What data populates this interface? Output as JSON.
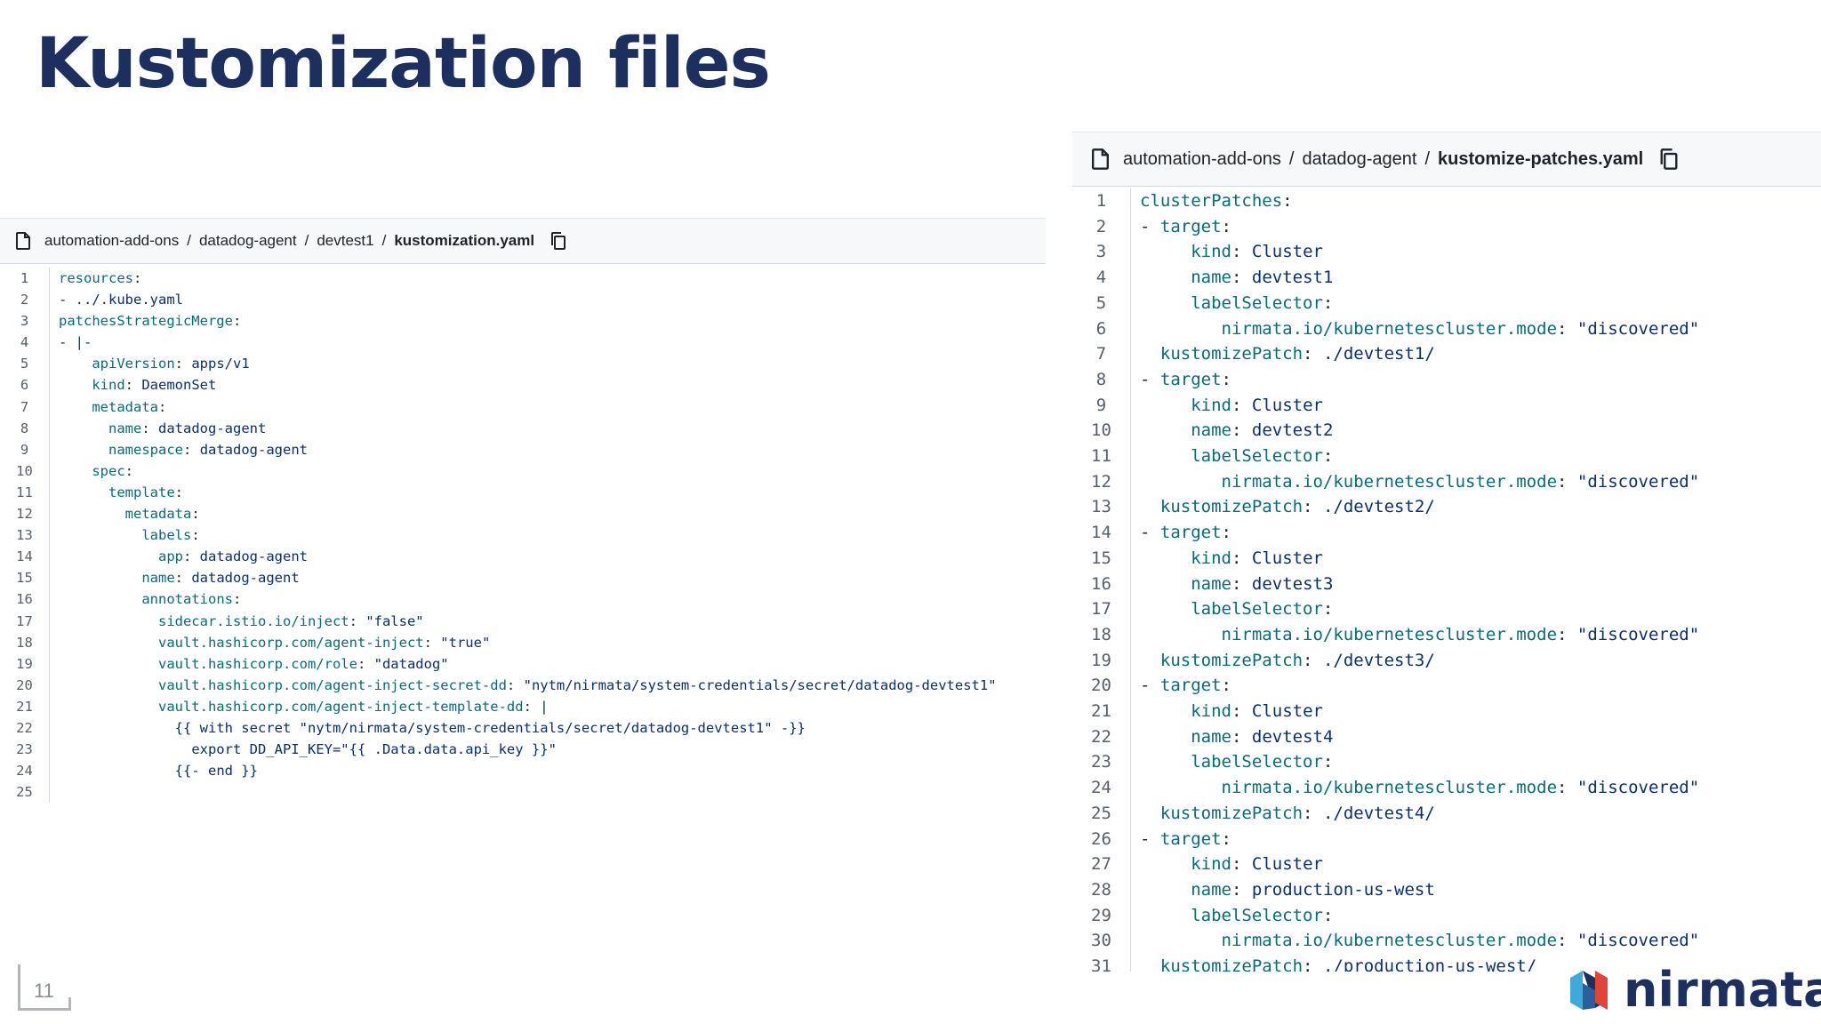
{
  "slide": {
    "title": "Kustomization files",
    "page_number": "11",
    "brand": "nirmata",
    "colors": {
      "title": "#1c2f5e",
      "key": "#0a6a78",
      "value": "#0a3069",
      "header_bg": "#f6f8fa"
    }
  },
  "left_file": {
    "breadcrumb": [
      "automation-add-ons",
      "datadog-agent",
      "devtest1"
    ],
    "filename": "kustomization.yaml",
    "icons": {
      "file": "file-icon",
      "copy": "copy-icon"
    },
    "lines": [
      {
        "indent": "",
        "key": "resources",
        "value": ""
      },
      {
        "indent": "",
        "dash": "- ",
        "value": "../.kube.yaml"
      },
      {
        "indent": "",
        "key": "patchesStrategicMerge",
        "value": ""
      },
      {
        "indent": "",
        "dash": "- ",
        "value": "|-"
      },
      {
        "indent": "    ",
        "key": "apiVersion",
        "value": "apps/v1"
      },
      {
        "indent": "    ",
        "key": "kind",
        "value": "DaemonSet"
      },
      {
        "indent": "    ",
        "key": "metadata",
        "value": ""
      },
      {
        "indent": "      ",
        "key": "name",
        "value": "datadog-agent"
      },
      {
        "indent": "      ",
        "key": "namespace",
        "value": "datadog-agent"
      },
      {
        "indent": "    ",
        "key": "spec",
        "value": ""
      },
      {
        "indent": "      ",
        "key": "template",
        "value": ""
      },
      {
        "indent": "        ",
        "key": "metadata",
        "value": ""
      },
      {
        "indent": "          ",
        "key": "labels",
        "value": ""
      },
      {
        "indent": "            ",
        "key": "app",
        "value": "datadog-agent"
      },
      {
        "indent": "          ",
        "key": "name",
        "value": "datadog-agent"
      },
      {
        "indent": "          ",
        "key": "annotations",
        "value": ""
      },
      {
        "indent": "            ",
        "key": "sidecar.istio.io/inject",
        "value": "\"false\""
      },
      {
        "indent": "            ",
        "key": "vault.hashicorp.com/agent-inject",
        "value": "\"true\""
      },
      {
        "indent": "            ",
        "key": "vault.hashicorp.com/role",
        "value": "\"datadog\""
      },
      {
        "indent": "            ",
        "key": "vault.hashicorp.com/agent-inject-secret-dd",
        "value": "\"nytm/nirmata/system-credentials/secret/datadog-devtest1\""
      },
      {
        "indent": "            ",
        "key": "vault.hashicorp.com/agent-inject-template-dd",
        "value": "|"
      },
      {
        "indent": "              ",
        "value": "{{ with secret \"nytm/nirmata/system-credentials/secret/datadog-devtest1\" -}}"
      },
      {
        "indent": "                ",
        "value": "export DD_API_KEY=\"{{ .Data.data.api_key }}\""
      },
      {
        "indent": "              ",
        "value": "{{- end }}"
      },
      {
        "indent": "",
        "value": ""
      }
    ]
  },
  "right_file": {
    "breadcrumb": [
      "automation-add-ons",
      "datadog-agent"
    ],
    "filename": "kustomize-patches.yaml",
    "icons": {
      "file": "file-icon",
      "copy": "copy-icon"
    },
    "lines": [
      {
        "indent": "",
        "key": "clusterPatches",
        "value": ""
      },
      {
        "indent": "",
        "dash": "- ",
        "key": "target",
        "value": ""
      },
      {
        "indent": "     ",
        "key": "kind",
        "value": "Cluster"
      },
      {
        "indent": "     ",
        "key": "name",
        "value": "devtest1"
      },
      {
        "indent": "     ",
        "key": "labelSelector",
        "value": ""
      },
      {
        "indent": "        ",
        "key": "nirmata.io/kubernetescluster.mode",
        "value": "\"discovered\""
      },
      {
        "indent": "  ",
        "key": "kustomizePatch",
        "value": "./devtest1/"
      },
      {
        "indent": "",
        "dash": "- ",
        "key": "target",
        "value": ""
      },
      {
        "indent": "     ",
        "key": "kind",
        "value": "Cluster"
      },
      {
        "indent": "     ",
        "key": "name",
        "value": "devtest2"
      },
      {
        "indent": "     ",
        "key": "labelSelector",
        "value": ""
      },
      {
        "indent": "        ",
        "key": "nirmata.io/kubernetescluster.mode",
        "value": "\"discovered\""
      },
      {
        "indent": "  ",
        "key": "kustomizePatch",
        "value": "./devtest2/"
      },
      {
        "indent": "",
        "dash": "- ",
        "key": "target",
        "value": ""
      },
      {
        "indent": "     ",
        "key": "kind",
        "value": "Cluster"
      },
      {
        "indent": "     ",
        "key": "name",
        "value": "devtest3"
      },
      {
        "indent": "     ",
        "key": "labelSelector",
        "value": ""
      },
      {
        "indent": "        ",
        "key": "nirmata.io/kubernetescluster.mode",
        "value": "\"discovered\""
      },
      {
        "indent": "  ",
        "key": "kustomizePatch",
        "value": "./devtest3/"
      },
      {
        "indent": "",
        "dash": "- ",
        "key": "target",
        "value": ""
      },
      {
        "indent": "     ",
        "key": "kind",
        "value": "Cluster"
      },
      {
        "indent": "     ",
        "key": "name",
        "value": "devtest4"
      },
      {
        "indent": "     ",
        "key": "labelSelector",
        "value": ""
      },
      {
        "indent": "        ",
        "key": "nirmata.io/kubernetescluster.mode",
        "value": "\"discovered\""
      },
      {
        "indent": "  ",
        "key": "kustomizePatch",
        "value": "./devtest4/"
      },
      {
        "indent": "",
        "dash": "- ",
        "key": "target",
        "value": ""
      },
      {
        "indent": "     ",
        "key": "kind",
        "value": "Cluster"
      },
      {
        "indent": "     ",
        "key": "name",
        "value": "production-us-west"
      },
      {
        "indent": "     ",
        "key": "labelSelector",
        "value": ""
      },
      {
        "indent": "        ",
        "key": "nirmata.io/kubernetescluster.mode",
        "value": "\"discovered\""
      },
      {
        "indent": "  ",
        "key": "kustomizePatch",
        "value": "./production-us-west/"
      }
    ]
  }
}
